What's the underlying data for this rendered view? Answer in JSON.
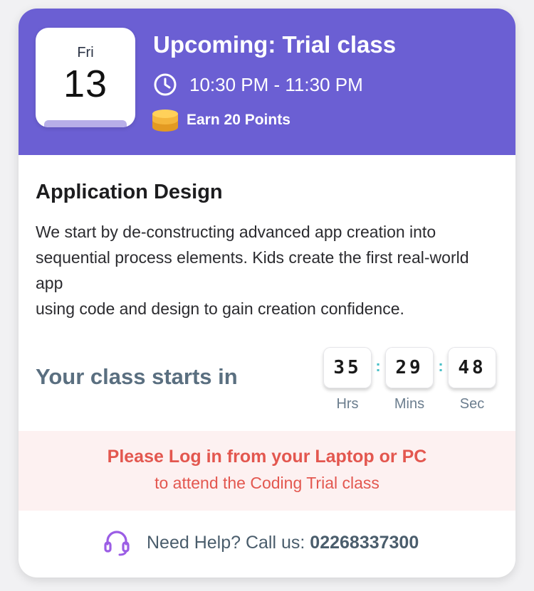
{
  "header": {
    "date": {
      "weekday": "Fri",
      "day": "13"
    },
    "title": "Upcoming: Trial class",
    "time": "10:30 PM - 11:30 PM",
    "points": "Earn 20 Points",
    "icons": {
      "clock": "clock-icon",
      "points": "coin-stack-icon"
    },
    "colors": {
      "background": "#6b5fd3",
      "coin": "#f4b63c"
    }
  },
  "course": {
    "title": "Application Design",
    "description": "We start by de-constructing advanced app creation into\nsequential process elements. Kids create the first real-world\napp\nusing code and design to gain creation confidence."
  },
  "countdown": {
    "label": "Your class starts in",
    "hours": "35",
    "minutes": "29",
    "seconds": "48",
    "hours_label": "Hrs",
    "minutes_label": "Mins",
    "seconds_label": "Sec",
    "separator": ":"
  },
  "notice": {
    "line1": "Please Log in from your Laptop or PC",
    "line2": "to attend the Coding Trial class",
    "color": "#e3574f"
  },
  "help": {
    "label": "Need Help? Call us: ",
    "phone": "02268337300",
    "icon": "headset-icon"
  }
}
